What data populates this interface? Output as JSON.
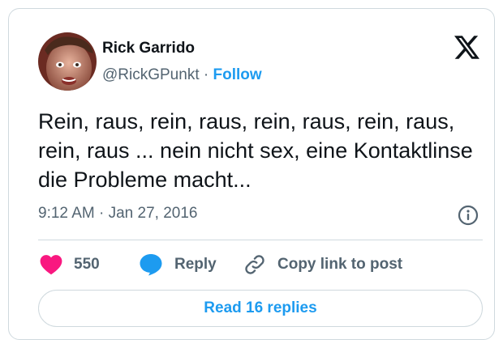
{
  "author": {
    "name": "Rick Garrido",
    "handle": "@RickGPunkt",
    "separator": " · ",
    "follow_label": "Follow"
  },
  "tweet": {
    "text": "Rein, raus, rein, raus, rein, raus, rein, raus, rein, raus ... nein nicht sex, eine Kontaktlinse die Probleme macht...",
    "time": "9:12 AM",
    "date_separator": " · ",
    "date": "Jan 27, 2016"
  },
  "actions": {
    "like_count": "550",
    "reply_label": "Reply",
    "copy_label": "Copy link to post"
  },
  "footer": {
    "read_replies_label": "Read 16 replies"
  },
  "colors": {
    "accent": "#1d9bf0",
    "like": "#f91880",
    "text_primary": "#0f1419",
    "text_secondary": "#536471",
    "border": "#cfd9de"
  }
}
